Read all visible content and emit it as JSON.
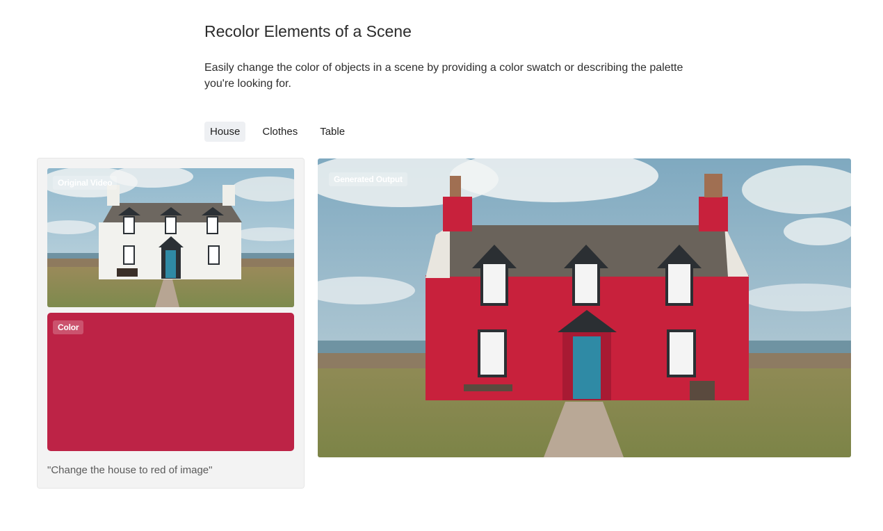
{
  "header": {
    "title": "Recolor Elements of a Scene",
    "description": "Easily change the color of objects in a scene by providing a color swatch or describing the palette you're looking for."
  },
  "tabs": [
    {
      "label": "House",
      "active": true
    },
    {
      "label": "Clothes",
      "active": false
    },
    {
      "label": "Table",
      "active": false
    }
  ],
  "input_panel": {
    "original_label": "Original Video",
    "color_label": "Color",
    "swatch_color": "#bd2346",
    "prompt": "\"Change the house to red of image\""
  },
  "output": {
    "label": "Generated Output"
  },
  "colors": {
    "house_original": "#f2f2ee",
    "house_recolored": "#c8213c",
    "door": "#2f8aa5"
  }
}
